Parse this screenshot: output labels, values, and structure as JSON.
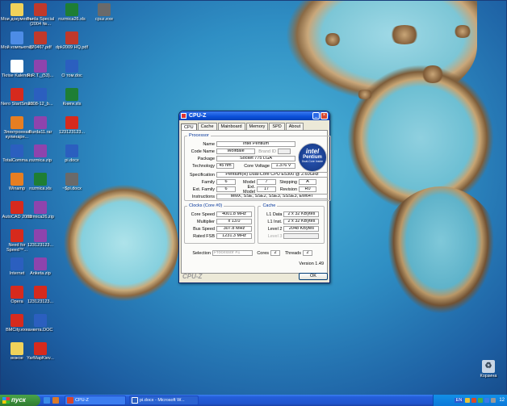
{
  "desktop_icons": [
    {
      "name": "my-documents",
      "label": "Мои документы",
      "color": "#f0d25a"
    },
    {
      "name": "burda-special",
      "label": "Burda Special (2004 №...",
      "color": "#c0392b"
    },
    {
      "name": "rozmice-xls",
      "label": "rozmica26.xls",
      "color": "#1e7e34"
    },
    {
      "name": "cpuz-exe",
      "label": "cpuz.exe",
      "color": "#6a6a6a"
    },
    {
      "name": "my-computer",
      "label": "Мой компьютер",
      "color": "#4d8ce6"
    },
    {
      "name": "pdf-320467",
      "label": "320467.pdf",
      "color": "#c0392b"
    },
    {
      "name": "pdf-dpk2009",
      "label": "dpk2009 HQ.pdf",
      "color": "#c0392b"
    },
    {
      "name": "tkrise-kalender",
      "label": "Tkrise Kalender",
      "color": "#ffffff"
    },
    {
      "name": "rar-rrt",
      "label": "R.R.T._(53)...",
      "color": "#8e44ad"
    },
    {
      "name": "doc-o-tom",
      "label": "О том.doc",
      "color": "#2b5fbf"
    },
    {
      "name": "nero-startsmart",
      "label": "Nero StartSmart",
      "color": "#d62a1d"
    },
    {
      "name": "doc-2008",
      "label": "2008-12_b...",
      "color": "#2b5fbf"
    },
    {
      "name": "xls-knigi",
      "label": "Книги.xls",
      "color": "#1e7e34"
    },
    {
      "name": "e-culinary",
      "label": "Электронная кулинарн...",
      "color": "#e67e22"
    },
    {
      "name": "rar-burda11",
      "label": "Burda11.rar",
      "color": "#8e44ad"
    },
    {
      "name": "zip-123",
      "label": "123123123...",
      "color": "#d62a1d"
    },
    {
      "name": "totalcommander",
      "label": "TotalComma...",
      "color": "#2b5fbf"
    },
    {
      "name": "rozmica-zip",
      "label": "rozmica.zip",
      "color": "#8e44ad"
    },
    {
      "name": "pi-docx",
      "label": "pi.docx",
      "color": "#2b5fbf"
    },
    {
      "name": "winamp",
      "label": "Winamp",
      "color": "#e67e22"
    },
    {
      "name": "rozmica-xls2",
      "label": "rozmica.xls",
      "color": "#1e7e34"
    },
    {
      "name": "file-pi-docx",
      "label": "~$pi.docx",
      "color": "#6a6a6a"
    },
    {
      "name": "autocad",
      "label": "AutoCAD 2008",
      "color": "#d62a1d"
    },
    {
      "name": "rozmica26-zip",
      "label": "rozmica26.zip",
      "color": "#8e44ad"
    },
    {
      "name": "need-for-speed",
      "label": "Need for Speed™...",
      "color": "#d62a1d"
    },
    {
      "name": "rar-123",
      "label": "123123123...",
      "color": "#8e44ad"
    },
    {
      "name": "internet",
      "label": "Internet",
      "color": "#2b5fbf"
    },
    {
      "name": "anketa-zip",
      "label": "Anketa.zip",
      "color": "#8e44ad"
    },
    {
      "name": "opera",
      "label": "Opera",
      "color": "#d62a1d"
    },
    {
      "name": "doc-123",
      "label": "123123123...",
      "color": "#d62a1d"
    },
    {
      "name": "bmcity-exe",
      "label": "BMCity.exe",
      "color": "#d62a1d"
    },
    {
      "name": "anketa-doc",
      "label": "анкета.DOC",
      "color": "#2b5fbf"
    },
    {
      "name": "vozhoe",
      "label": "вожое",
      "color": "#f0d25a"
    },
    {
      "name": "yarmap",
      "label": "YarMapKiev...",
      "color": "#d62a1d"
    }
  ],
  "recycle_bin": {
    "label": "Корзина"
  },
  "cpuz": {
    "title": "CPU-Z",
    "tabs": [
      "CPU",
      "Cache",
      "Mainboard",
      "Memory",
      "SPD",
      "About"
    ],
    "processor": {
      "legend": "Processor",
      "name_label": "Name",
      "name": "Intel Pentium",
      "codename_label": "Code Name",
      "codename": "Wolfdale",
      "brand_id_label": "Brand ID",
      "package_label": "Package",
      "package": "Socket 775 LGA",
      "technology_label": "Technology",
      "technology": "45 nm",
      "core_voltage_label": "Core Voltage",
      "core_voltage": "1.376 V",
      "spec_label": "Specification",
      "spec": "Pentium(R) Dual-Core CPU E5300 @ 2.60GHz",
      "family_label": "Family",
      "family": "6",
      "model_label": "Model",
      "model": "7",
      "stepping_label": "Stepping",
      "stepping": "A",
      "ext_family_label": "Ext. Family",
      "ext_family": "6",
      "ext_model_label": "Ext. Model",
      "ext_model": "17",
      "revision_label": "Revision",
      "revision": "R0",
      "instructions_label": "Instructions",
      "instructions": "MMX, SSE, SSE2, SSE3, SSSE3, EM64T"
    },
    "logo": {
      "l1": "intel",
      "l2": "Pentium",
      "l3": "Dual-Core Inside"
    },
    "clocks": {
      "legend": "Clocks (Core #0)",
      "core_speed_label": "Core Speed",
      "core_speed": "4001.8 MHz",
      "multiplier_label": "Multiplier",
      "multiplier": "x 13.0",
      "bus_speed_label": "Bus Speed",
      "bus_speed": "307.8 MHz",
      "rated_fsb_label": "Rated FSB",
      "rated_fsb": "1231.3 MHz"
    },
    "cache": {
      "legend": "Cache",
      "l1d_label": "L1 Data",
      "l1d": "2 x 32 KBytes",
      "l1i_label": "L1 Inst.",
      "l1i": "2 x 32 KBytes",
      "l2_label": "Level 2",
      "l2": "2048 KBytes",
      "l3_label": "Level 3",
      "l3": ""
    },
    "selection_label": "Selection",
    "selection": "Processor #1",
    "cores_label": "Cores",
    "cores": "2",
    "threads_label": "Threads",
    "threads": "2",
    "version": "Version 1.49",
    "brand": "CPU-Z",
    "ok": "OK"
  },
  "taskbar": {
    "start": "пуск",
    "items": [
      {
        "label": "CPU-Z",
        "color": "#d5452d"
      },
      {
        "label": "pi.docx - Microsoft W...",
        "color": "#2b5fbf"
      }
    ],
    "lang": "EN",
    "clock": "12"
  }
}
